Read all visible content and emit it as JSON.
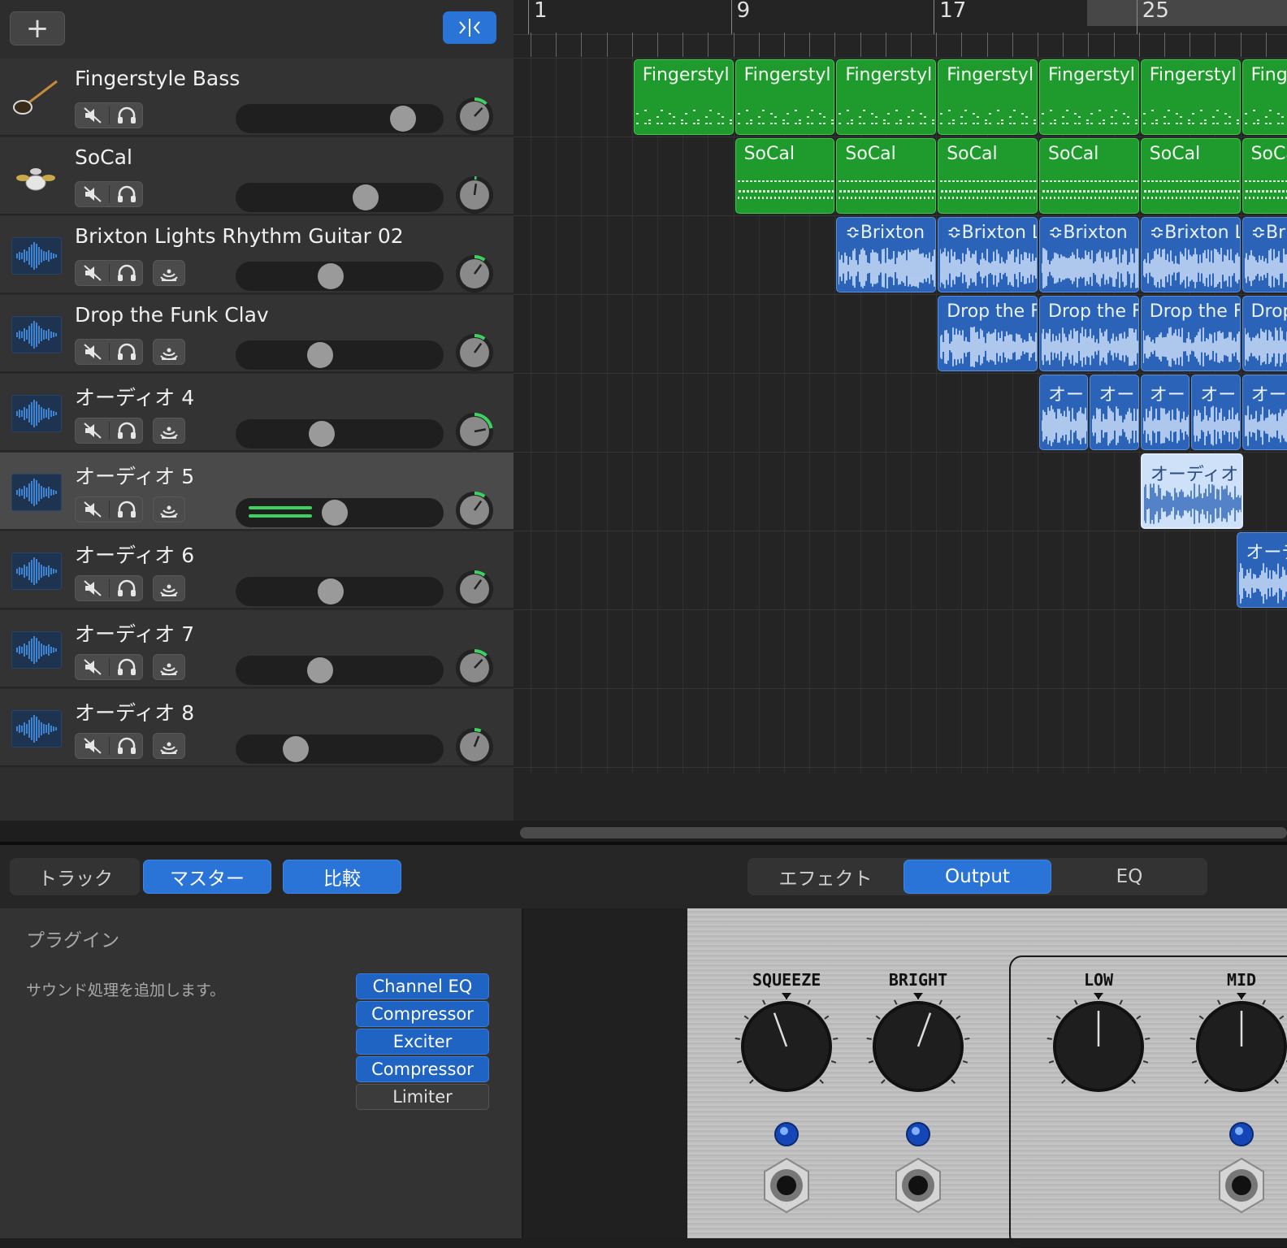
{
  "header": {
    "add_label": "+",
    "add_icon": "plus-icon",
    "smart_icon": "smart-controls-icon"
  },
  "tracks": [
    {
      "name": "Fingerstyle Bass",
      "icon": "bass-guitar-icon",
      "has_monitor": false,
      "volume": 0.86,
      "pan": 0.12,
      "selected": false
    },
    {
      "name": "SoCal",
      "icon": "drum-kit-icon",
      "has_monitor": false,
      "volume": 0.65,
      "pan": 0.02,
      "selected": false
    },
    {
      "name": "Brixton Lights Rhythm Guitar 02",
      "icon": "audio-waveform-icon",
      "has_monitor": true,
      "volume": 0.45,
      "pan": 0.1,
      "selected": false
    },
    {
      "name": "Drop the Funk Clav",
      "icon": "audio-waveform-icon",
      "has_monitor": true,
      "volume": 0.39,
      "pan": 0.1,
      "selected": false
    },
    {
      "name": "オーディオ 4",
      "icon": "audio-waveform-icon",
      "has_monitor": true,
      "volume": 0.4,
      "pan": 0.22,
      "selected": false
    },
    {
      "name": "オーディオ 5",
      "icon": "audio-waveform-icon",
      "has_monitor": true,
      "volume": 0.47,
      "pan": 0.1,
      "selected": true
    },
    {
      "name": "オーディオ 6",
      "icon": "audio-waveform-icon",
      "has_monitor": true,
      "volume": 0.45,
      "pan": 0.1,
      "selected": false
    },
    {
      "name": "オーディオ 7",
      "icon": "audio-waveform-icon",
      "has_monitor": true,
      "volume": 0.39,
      "pan": 0.12,
      "selected": false
    },
    {
      "name": "オーディオ 8",
      "icon": "audio-waveform-icon",
      "has_monitor": true,
      "volume": 0.25,
      "pan": 0.06,
      "selected": false
    }
  ],
  "ruler": {
    "bars": [
      "1",
      "9",
      "17",
      "25"
    ]
  },
  "regions": {
    "fingerstyle": [
      "Fingerstyl",
      "Fingerstyl",
      "Fingerstyl",
      "Fingerstyl",
      "Fingerstyl",
      "Fingerstyl",
      "Finge"
    ],
    "socal": [
      "SoCal",
      "SoCal",
      "SoCal",
      "SoCal",
      "SoCal",
      "SoCa"
    ],
    "brixton": [
      "Brixton",
      "Brixton L",
      "Brixton",
      "Brixton L",
      "Bri"
    ],
    "clav": [
      "Drop the F",
      "Drop the F",
      "Drop the F",
      "Drop"
    ],
    "audio4": [
      "オー",
      "オー",
      "オー",
      "オー",
      "オー"
    ],
    "audio5": [
      "オーディオ"
    ],
    "audio6": [
      "オーデ"
    ]
  },
  "smart_controls": {
    "tabs_left": [
      "トラック",
      "マスター",
      "比較"
    ],
    "tabs_right": [
      "エフェクト",
      "Output",
      "EQ"
    ],
    "plugin_title": "プラグイン",
    "plugin_desc": "サウンド処理を追加します。",
    "plugins": [
      {
        "name": "Channel EQ",
        "active": true
      },
      {
        "name": "Compressor",
        "active": true
      },
      {
        "name": "Exciter",
        "active": true
      },
      {
        "name": "Compressor",
        "active": true
      },
      {
        "name": "Limiter",
        "active": false
      }
    ],
    "amp_knobs": [
      "SQUEEZE",
      "BRIGHT",
      "LOW",
      "MID"
    ]
  },
  "colors": {
    "accent": "#2a74d8",
    "midi_region": "#1f9a2c",
    "audio_region": "#2a63b8",
    "level_meter": "#3dd160"
  }
}
